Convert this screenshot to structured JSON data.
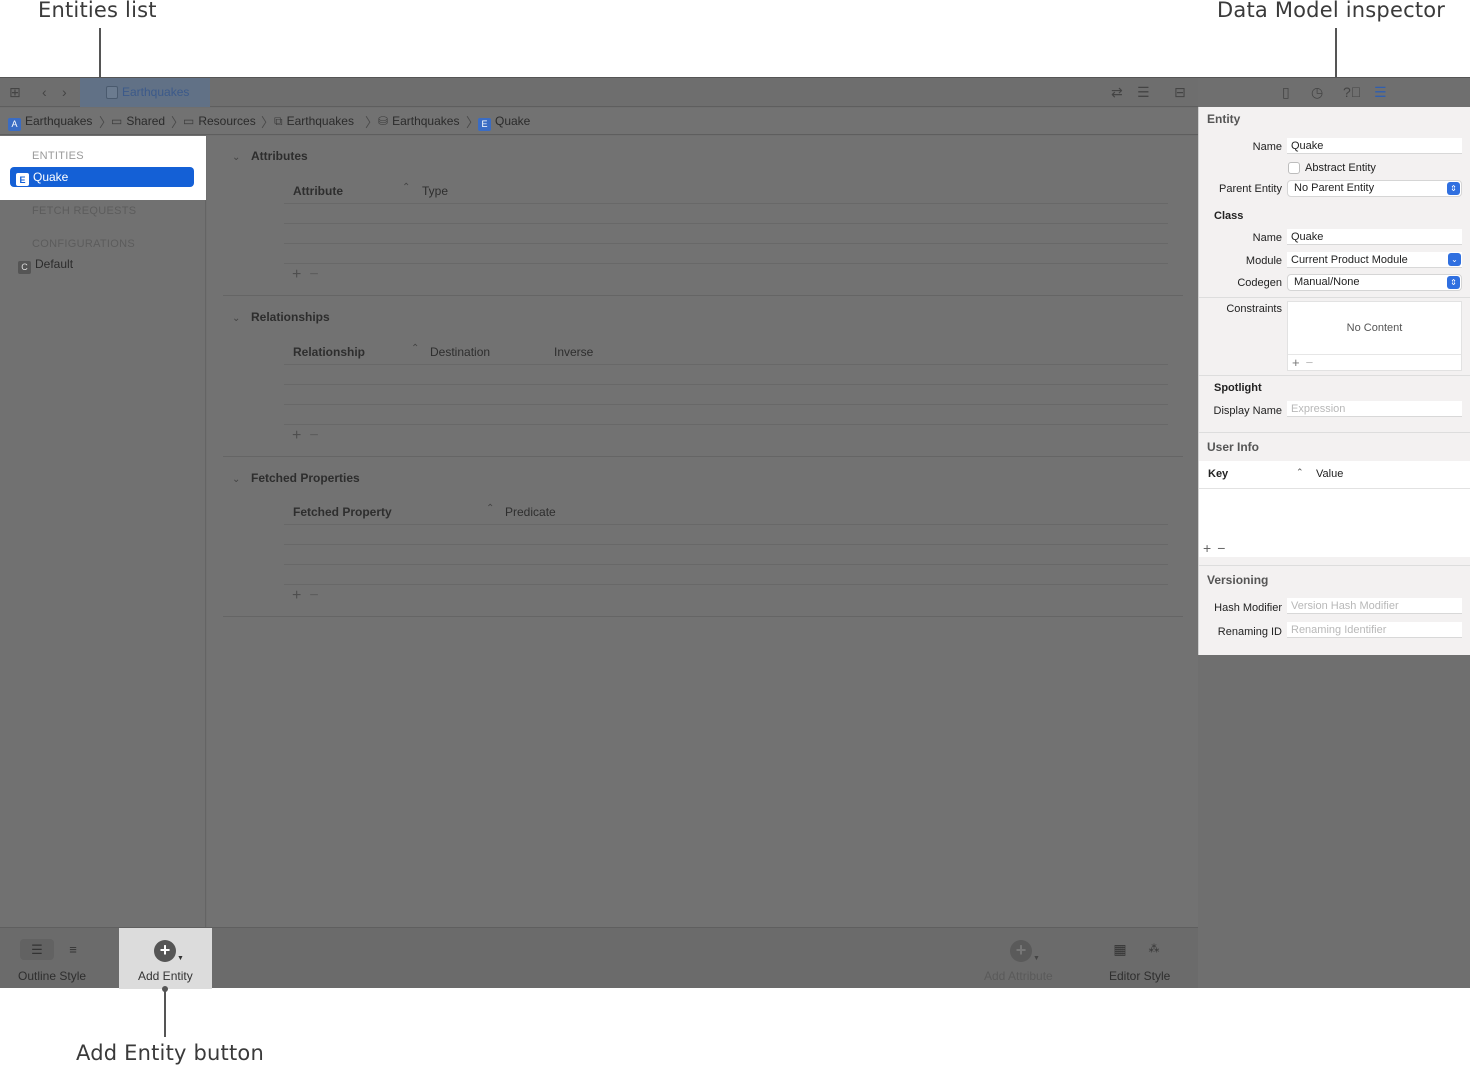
{
  "callouts": {
    "entities_list": "Entities list",
    "inspector": "Data Model inspector",
    "add_entity_button": "Add Entity button"
  },
  "toolbar": {
    "file_tab": "Earthquakes"
  },
  "jump_bar": {
    "crumbs": [
      "Earthquakes",
      "Shared",
      "Resources",
      "Earthquakes",
      "Earthquakes",
      "Quake"
    ]
  },
  "sidebar": {
    "entities_header": "ENTITIES",
    "entities": [
      {
        "icon_letter": "E",
        "label": "Quake"
      }
    ],
    "fetch_requests_header": "FETCH REQUESTS",
    "configurations_header": "CONFIGURATIONS",
    "configurations": [
      {
        "icon_letter": "C",
        "label": "Default"
      }
    ]
  },
  "editor": {
    "attributes": {
      "title": "Attributes",
      "columns": [
        "Attribute",
        "Type"
      ]
    },
    "relationships": {
      "title": "Relationships",
      "columns": [
        "Relationship",
        "Destination",
        "Inverse"
      ]
    },
    "fetched_properties": {
      "title": "Fetched Properties",
      "columns": [
        "Fetched Property",
        "Predicate"
      ]
    },
    "add_symbol": "+",
    "remove_symbol": "−"
  },
  "bottom_bar": {
    "outline_style": "Outline Style",
    "add_entity": "Add Entity",
    "add_attribute": "Add Attribute",
    "editor_style": "Editor Style"
  },
  "inspector": {
    "entity": {
      "header": "Entity",
      "name_label": "Name",
      "name_value": "Quake",
      "abstract_label": "Abstract Entity",
      "abstract_checked": false,
      "parent_label": "Parent Entity",
      "parent_value": "No Parent Entity"
    },
    "class": {
      "header": "Class",
      "name_label": "Name",
      "name_value": "Quake",
      "module_label": "Module",
      "module_value": "Current Product Module",
      "codegen_label": "Codegen",
      "codegen_value": "Manual/None"
    },
    "constraints": {
      "label": "Constraints",
      "empty_text": "No Content"
    },
    "spotlight": {
      "header": "Spotlight",
      "display_name_label": "Display Name",
      "display_name_placeholder": "Expression"
    },
    "user_info": {
      "header": "User Info",
      "columns": [
        "Key",
        "Value"
      ]
    },
    "versioning": {
      "header": "Versioning",
      "hash_label": "Hash Modifier",
      "hash_placeholder": "Version Hash Modifier",
      "renaming_label": "Renaming ID",
      "renaming_placeholder": "Renaming Identifier"
    }
  },
  "colors": {
    "selection_blue": "#1460d6",
    "dim_overlay": "#6f6f6f",
    "highlight": "#ffffff"
  }
}
